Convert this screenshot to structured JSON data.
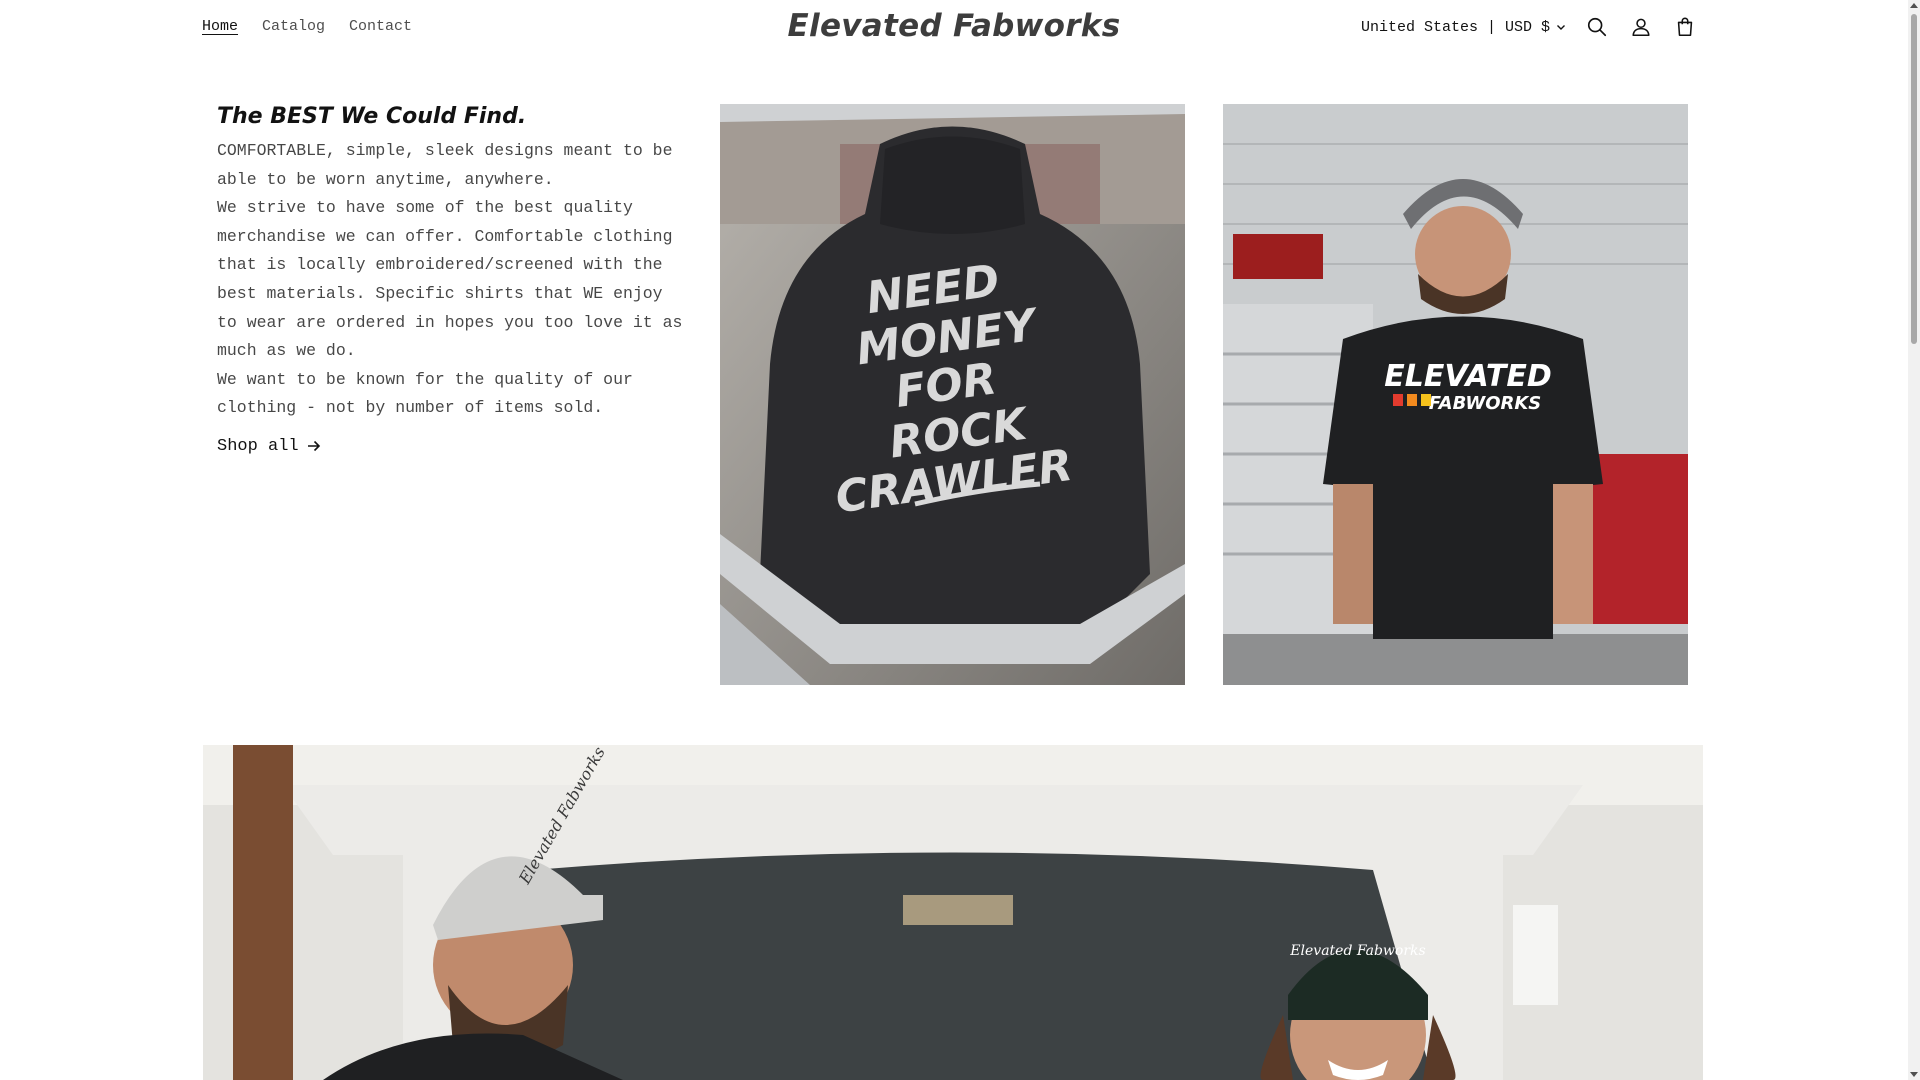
{
  "header": {
    "nav": [
      {
        "label": "Home",
        "active": true
      },
      {
        "label": "Catalog",
        "active": false
      },
      {
        "label": "Contact",
        "active": false
      }
    ],
    "logo": "Elevated Fabworks",
    "locale": "United States | USD $",
    "icons": [
      "search-icon",
      "account-icon",
      "cart-icon"
    ]
  },
  "intro": {
    "heading": "The BEST We Could Find.",
    "paragraphs": [
      "COMFORTABLE, simple, sleek designs meant to be able to be worn anytime, anywhere.",
      "We strive to have some of the best quality merchandise we can offer. Comfortable clothing that is locally embroidered/screened with the best materials. Specific shirts that WE enjoy to wear are ordered in hopes you too love it as much as we do.",
      "We want to be known for the quality of our clothing - not by number of items sold."
    ],
    "shop_all": "Shop all"
  },
  "images": {
    "hoodie_print": [
      "NEED",
      "MONEY",
      "FOR",
      "ROCK",
      "CRAWLER"
    ],
    "tee_print_top": "ELEVATED",
    "tee_print_bottom": "FABWORKS",
    "cap_logo": "Elevated Fabworks"
  },
  "colors": {
    "text": "#121212",
    "logo": "#3d3d3d",
    "hoodie": "#2b2b2e",
    "tee_stripes": [
      "#e23b2e",
      "#f28a1e",
      "#f6c21c"
    ]
  }
}
